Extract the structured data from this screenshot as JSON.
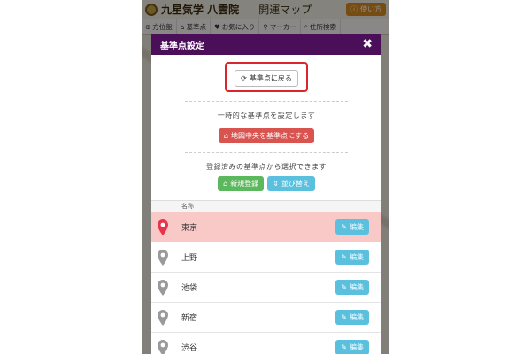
{
  "app": {
    "title": "九星気学 八雲院",
    "subtitle": "開運マップ",
    "help_label": "使い方",
    "toolbar": [
      {
        "label": "方位盤",
        "icon": "compass-icon"
      },
      {
        "label": "基準点",
        "icon": "home-icon"
      },
      {
        "label": "お気に入り",
        "icon": "heart-icon"
      },
      {
        "label": "マーカー",
        "icon": "marker-icon"
      },
      {
        "label": "住所検索",
        "icon": "search-icon"
      }
    ]
  },
  "modal": {
    "title": "基準点設定",
    "reset_label": "基準点に戻る",
    "temp_hint": "一時的な基準点を設定します",
    "center_label": "地図中央を基準点にする",
    "saved_hint": "登録済みの基準点から選択できます",
    "new_label": "新規登録",
    "sort_label": "並び替え",
    "column_name": "名称",
    "edit_label": "編集",
    "rows": [
      {
        "name": "東京",
        "active": true
      },
      {
        "name": "上野",
        "active": false
      },
      {
        "name": "池袋",
        "active": false
      },
      {
        "name": "新宿",
        "active": false
      },
      {
        "name": "渋谷",
        "active": false
      }
    ]
  },
  "colors": {
    "header": "#4b0f5a",
    "active_pin": "#e8334a",
    "inactive_pin": "#9a9a9a",
    "active_row": "#f9c9c8",
    "highlight": "#d9262c"
  }
}
